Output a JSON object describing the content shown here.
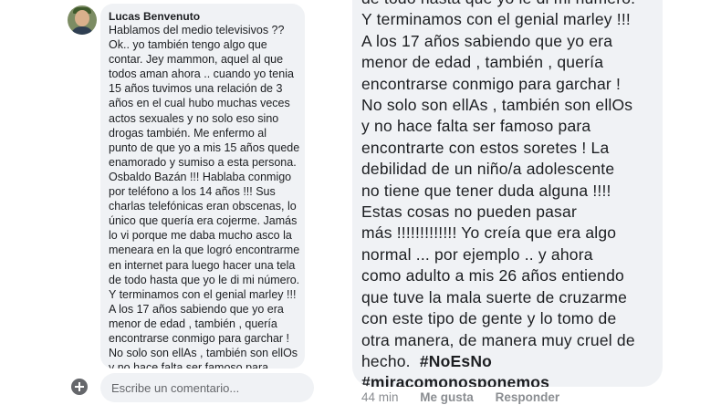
{
  "left_panel": {
    "author": "Lucas Benvenuto",
    "lines": [
      "Hablamos del medio televisivos ??",
      "Ok.. yo también tengo algo que",
      "contar. Jey mammon, aquel al que",
      "todos aman ahora .. cuando yo tenia",
      "15 años tuvimos una relación de 3",
      "años en el cual hubo muchas veces",
      "actos sexuales y no solo eso sino",
      "drogas también. Me enfermo al",
      "punto de que yo a mis 15 años quede",
      "enamorado y sumiso a esta persona.",
      "Osbaldo Bazán !!! Hablaba conmigo",
      "por teléfono a los 14 años !!! Sus",
      "charlas telefónicas eran obscenas, lo",
      "único que quería era cojerme. Jamás",
      "lo vi porque me daba mucho asco la",
      "meneara en la que logró encontrarme",
      "en internet para luego hacer una tela",
      "de todo hasta que yo le di mi número.",
      "Y terminamos con el genial marley !!!",
      "A los 17 años sabiendo que yo era",
      "menor de edad , también , quería",
      "encontrarse conmigo para garchar !",
      "No solo son ellAs , también son ellOs",
      "y no hace falta ser famoso para"
    ],
    "comment_placeholder": "Escribe un comentario..."
  },
  "right_panel": {
    "lines": [
      "de todo hasta que yo le di mi número.",
      "Y terminamos con el genial marley !!!",
      "A los 17 años sabiendo que yo era",
      "menor de edad , también , quería",
      "encontrarse conmigo para garchar !",
      "No solo son ellAs , también son ellOs",
      "y no hace falta ser famoso para",
      "encontrarte con estos soretes ! La",
      "debilidad de un niño/a adolescente",
      "no tiene que tener duda alguna !!!!",
      "Estas cosas no pueden pasar",
      "más !!!!!!!!!!!!! Yo creía que era algo",
      "normal ... por ejemplo .. y ahora",
      "como adulto a mis 26 años entiendo",
      "que tuve la mala suerte de cruzarme",
      "con este tipo de gente y lo tomo de",
      "otra manera, de manera muy cruel de",
      "hecho."
    ],
    "hashtag_1": "#NoEsNo",
    "hashtag_2": "#miracomonosponemos",
    "time": "44 min",
    "like_label": "Me gusta",
    "reply_label": "Responder"
  }
}
